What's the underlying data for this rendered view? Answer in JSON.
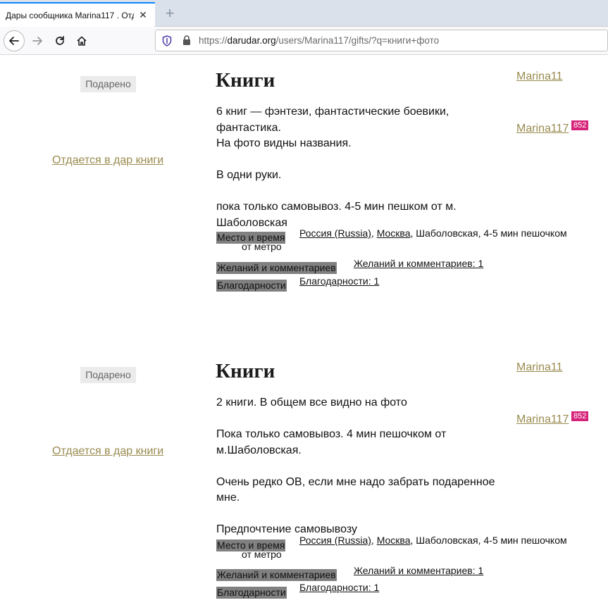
{
  "browser": {
    "tab_title": "Дары сообщника Marina117 . Отда",
    "tab_close": "✕",
    "new_tab": "+",
    "url_prefix": "https://",
    "url_domain": "darudar.org",
    "url_path": "/users/Marina117/gifts/?q=книги+фото"
  },
  "gifts": [
    {
      "status_badge": "Подарено",
      "category_link": "Отдается в дар книги",
      "title": "Книги",
      "description": [
        "6 книг — фэнтези, фантастические боевики,",
        "фантастика.",
        "На фото видны названия.",
        "",
        "В одни руки.",
        "",
        "пока только самовывоз. 4-5 мин пешком от м. Шаболовская"
      ],
      "user_short": "Marina11",
      "user_full": "Marina117",
      "karma": "852",
      "place_label": "Место и время",
      "place_label_sub": "от метро",
      "place_country": "Россия (Russia)",
      "place_city": "Москва",
      "place_rest": ", Шаболовская, 4-5 мин пешочком",
      "wishes_label": "Желаний и комментариев",
      "wishes_value": "Желаний и комментариев: 1",
      "thanks_label": "Благодарности",
      "thanks_value": "Благодарности: 1"
    },
    {
      "status_badge": "Подарено",
      "category_link": "Отдается в дар книги",
      "title": "Книги",
      "description": [
        "2 книги. В общем все видно на фото",
        "",
        "Пока только самовывоз. 4 мин пешочком от",
        "м.Шаболовская.",
        "",
        "Очень редко ОВ, если мне надо забрать подаренное мне.",
        "",
        "Предпочтение самовывозу"
      ],
      "user_short": "Marina11",
      "user_full": "Marina117",
      "karma": "852",
      "place_label": "Место и время",
      "place_label_sub": "от метро",
      "place_country": "Россия (Russia)",
      "place_city": "Москва",
      "place_rest": ", Шаболовская, 4-5 мин пешочком",
      "wishes_label": "Желаний и комментариев",
      "wishes_value": "Желаний и комментариев: 1",
      "thanks_label": "Благодарности",
      "thanks_value": "Благодарности: 1"
    }
  ]
}
